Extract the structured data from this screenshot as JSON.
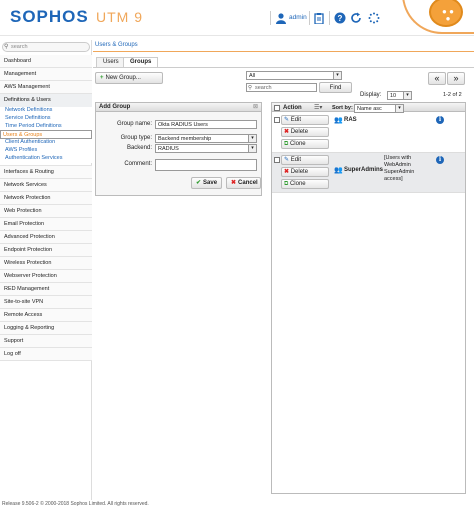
{
  "header": {
    "brand": "SOPHOS",
    "product": "UTM 9",
    "user": "admin",
    "icons": [
      "user-icon",
      "clipboard-icon",
      "help-icon",
      "refresh-icon",
      "spinner-icon"
    ]
  },
  "sidebar": {
    "search_placeholder": "search",
    "items": [
      {
        "label": "Dashboard"
      },
      {
        "label": "Management"
      },
      {
        "label": "AWS Management"
      },
      {
        "label": "Definitions & Users",
        "children": [
          "Network Definitions",
          "Service Definitions",
          "Time Period Definitions",
          "Users & Groups",
          "Client Authentication",
          "AWS Profiles",
          "Authentication Services"
        ],
        "selected_child": "Users & Groups"
      },
      {
        "label": "Interfaces & Routing"
      },
      {
        "label": "Network Services"
      },
      {
        "label": "Network Protection"
      },
      {
        "label": "Web Protection"
      },
      {
        "label": "Email Protection"
      },
      {
        "label": "Advanced Protection"
      },
      {
        "label": "Endpoint Protection"
      },
      {
        "label": "Wireless Protection"
      },
      {
        "label": "Webserver Protection"
      },
      {
        "label": "RED Management"
      },
      {
        "label": "Site-to-site VPN"
      },
      {
        "label": "Remote Access"
      },
      {
        "label": "Logging & Reporting"
      },
      {
        "label": "Support"
      },
      {
        "label": "Log off"
      }
    ]
  },
  "breadcrumb": "Users & Groups",
  "tabs": [
    {
      "label": "Users"
    },
    {
      "label": "Groups",
      "active": true
    }
  ],
  "toolbar": {
    "new_group": "New Group...",
    "filter_value": "All",
    "search_placeholder": "search",
    "find": "Find",
    "display_label": "Display:",
    "display_value": "10",
    "pager_prev": "«",
    "pager_next": "»",
    "page_info": "1-2 of 2"
  },
  "add_group": {
    "title": "Add Group",
    "close": "⊠",
    "fields": {
      "group_name_label": "Group name:",
      "group_name_value": "Okta RADIUS Users",
      "group_type_label": "Group type:",
      "group_type_value": "Backend membership",
      "backend_label": "Backend:",
      "backend_value": "RADIUS",
      "comment_label": "Comment:",
      "comment_value": ""
    },
    "save": "Save",
    "cancel": "Cancel"
  },
  "list": {
    "action_label": "Action",
    "sort_label": "Sort by:",
    "sort_value": "Name asc",
    "row_buttons": {
      "edit": "Edit",
      "delete": "Delete",
      "clone": "Clone"
    },
    "rows": [
      {
        "name": "RAS",
        "comment": ""
      },
      {
        "name": "SuperAdmins",
        "comment": "[Users with WebAdmin SuperAdmin access]"
      }
    ]
  },
  "footer": {
    "release": "Release 9.506-2  © 2000-2018 Sophos Limited. All rights reserved."
  },
  "colors": {
    "brand_blue": "#1e66b8",
    "accent_orange": "#f0a75a",
    "selected_nav": "#e8821a"
  }
}
